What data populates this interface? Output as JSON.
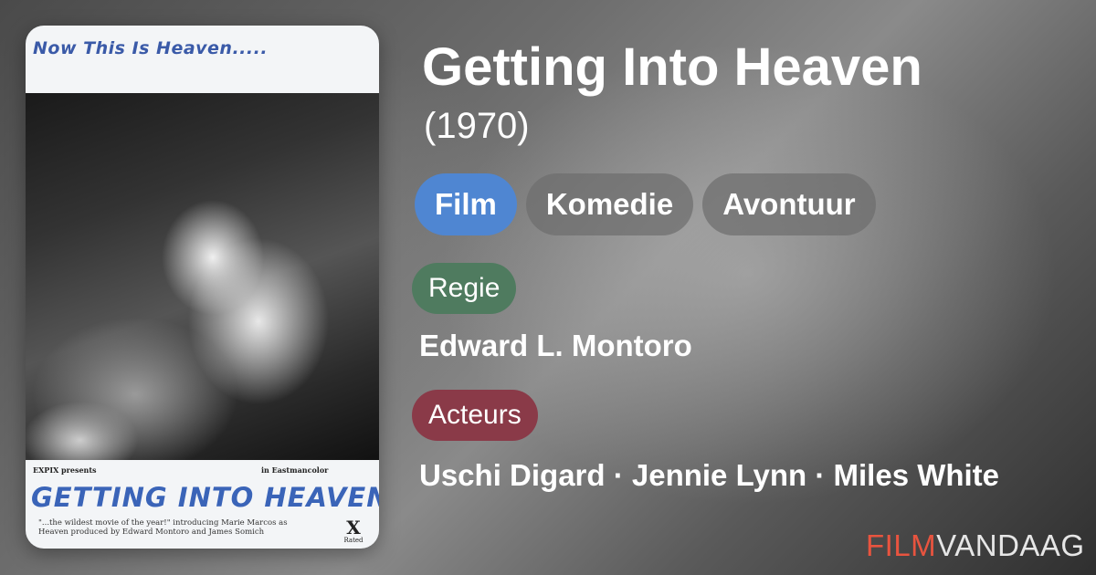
{
  "colors": {
    "genre_active": "#4f86d2",
    "genre_inactive": "#6e6e6e",
    "regie_badge": "#4f7b5f",
    "acteurs_badge": "#8a3a48",
    "logo_accent": "#e8543f"
  },
  "poster": {
    "tagline": "Now This Is Heaven.....",
    "credit_left": "EXPIX presents",
    "credit_right": "in Eastmancolor",
    "title": "GETTING INTO HEAVEN",
    "blurb": "\"...the wildest movie of the year!\" introducing Marie Marcos as Heaven produced by Edward Montoro and James Somich",
    "rating": "X",
    "rating_sub": "Rated"
  },
  "movie": {
    "title": "Getting Into Heaven",
    "year": "(1970)"
  },
  "genres": [
    {
      "label": "Film",
      "active": true
    },
    {
      "label": "Komedie",
      "active": false
    },
    {
      "label": "Avontuur",
      "active": false
    }
  ],
  "sections": {
    "regie_label": "Regie",
    "director": "Edward L. Montoro",
    "acteurs_label": "Acteurs",
    "actors": "Uschi Digard · Jennie Lynn · Miles White"
  },
  "logo": {
    "part1": "FILM",
    "part2": "VANDAAG"
  }
}
